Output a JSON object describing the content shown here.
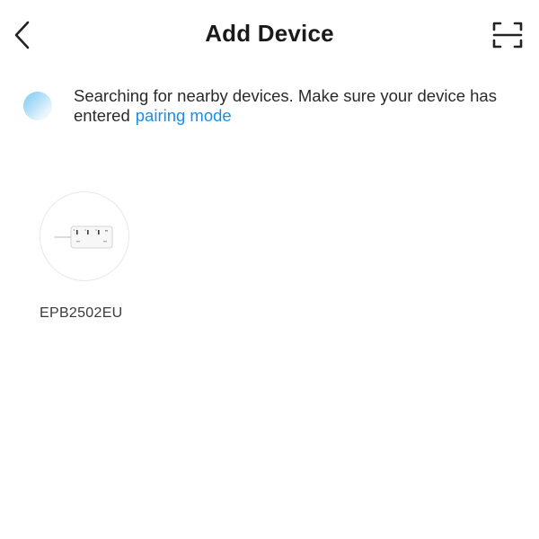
{
  "header": {
    "title": "Add Device",
    "back_icon": "chevron-left-icon",
    "scan_icon": "scan-icon"
  },
  "search": {
    "status_text": "Searching for nearby devices. Make sure your device has entered",
    "pairing_link": "pairing mode",
    "spinner_color": "#7cc8f2"
  },
  "devices": [
    {
      "name": "EPB2502EU",
      "icon": "power-strip-icon"
    }
  ],
  "colors": {
    "accent": "#1a8ee8",
    "text": "#1a1a1a"
  }
}
